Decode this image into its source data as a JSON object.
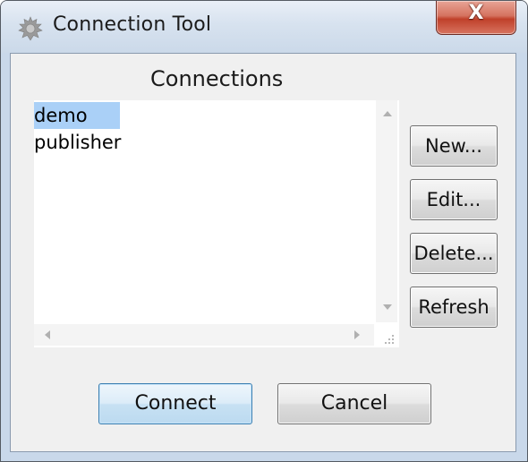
{
  "window": {
    "title": "Connection Tool",
    "app_icon": "gear-icon",
    "close_icon": "close-icon",
    "close_label": "X"
  },
  "connections": {
    "heading": "Connections",
    "items": [
      "demo",
      "publisher"
    ],
    "selected_index": 0
  },
  "side_buttons": {
    "new_label": "New...",
    "edit_label": "Edit...",
    "delete_label": "Delete...",
    "refresh_label": "Refresh"
  },
  "footer": {
    "connect_label": "Connect",
    "cancel_label": "Cancel"
  },
  "colors": {
    "selection": "#aad0f7",
    "close_button": "#c0402a",
    "default_button_border": "#3c7fb1"
  }
}
